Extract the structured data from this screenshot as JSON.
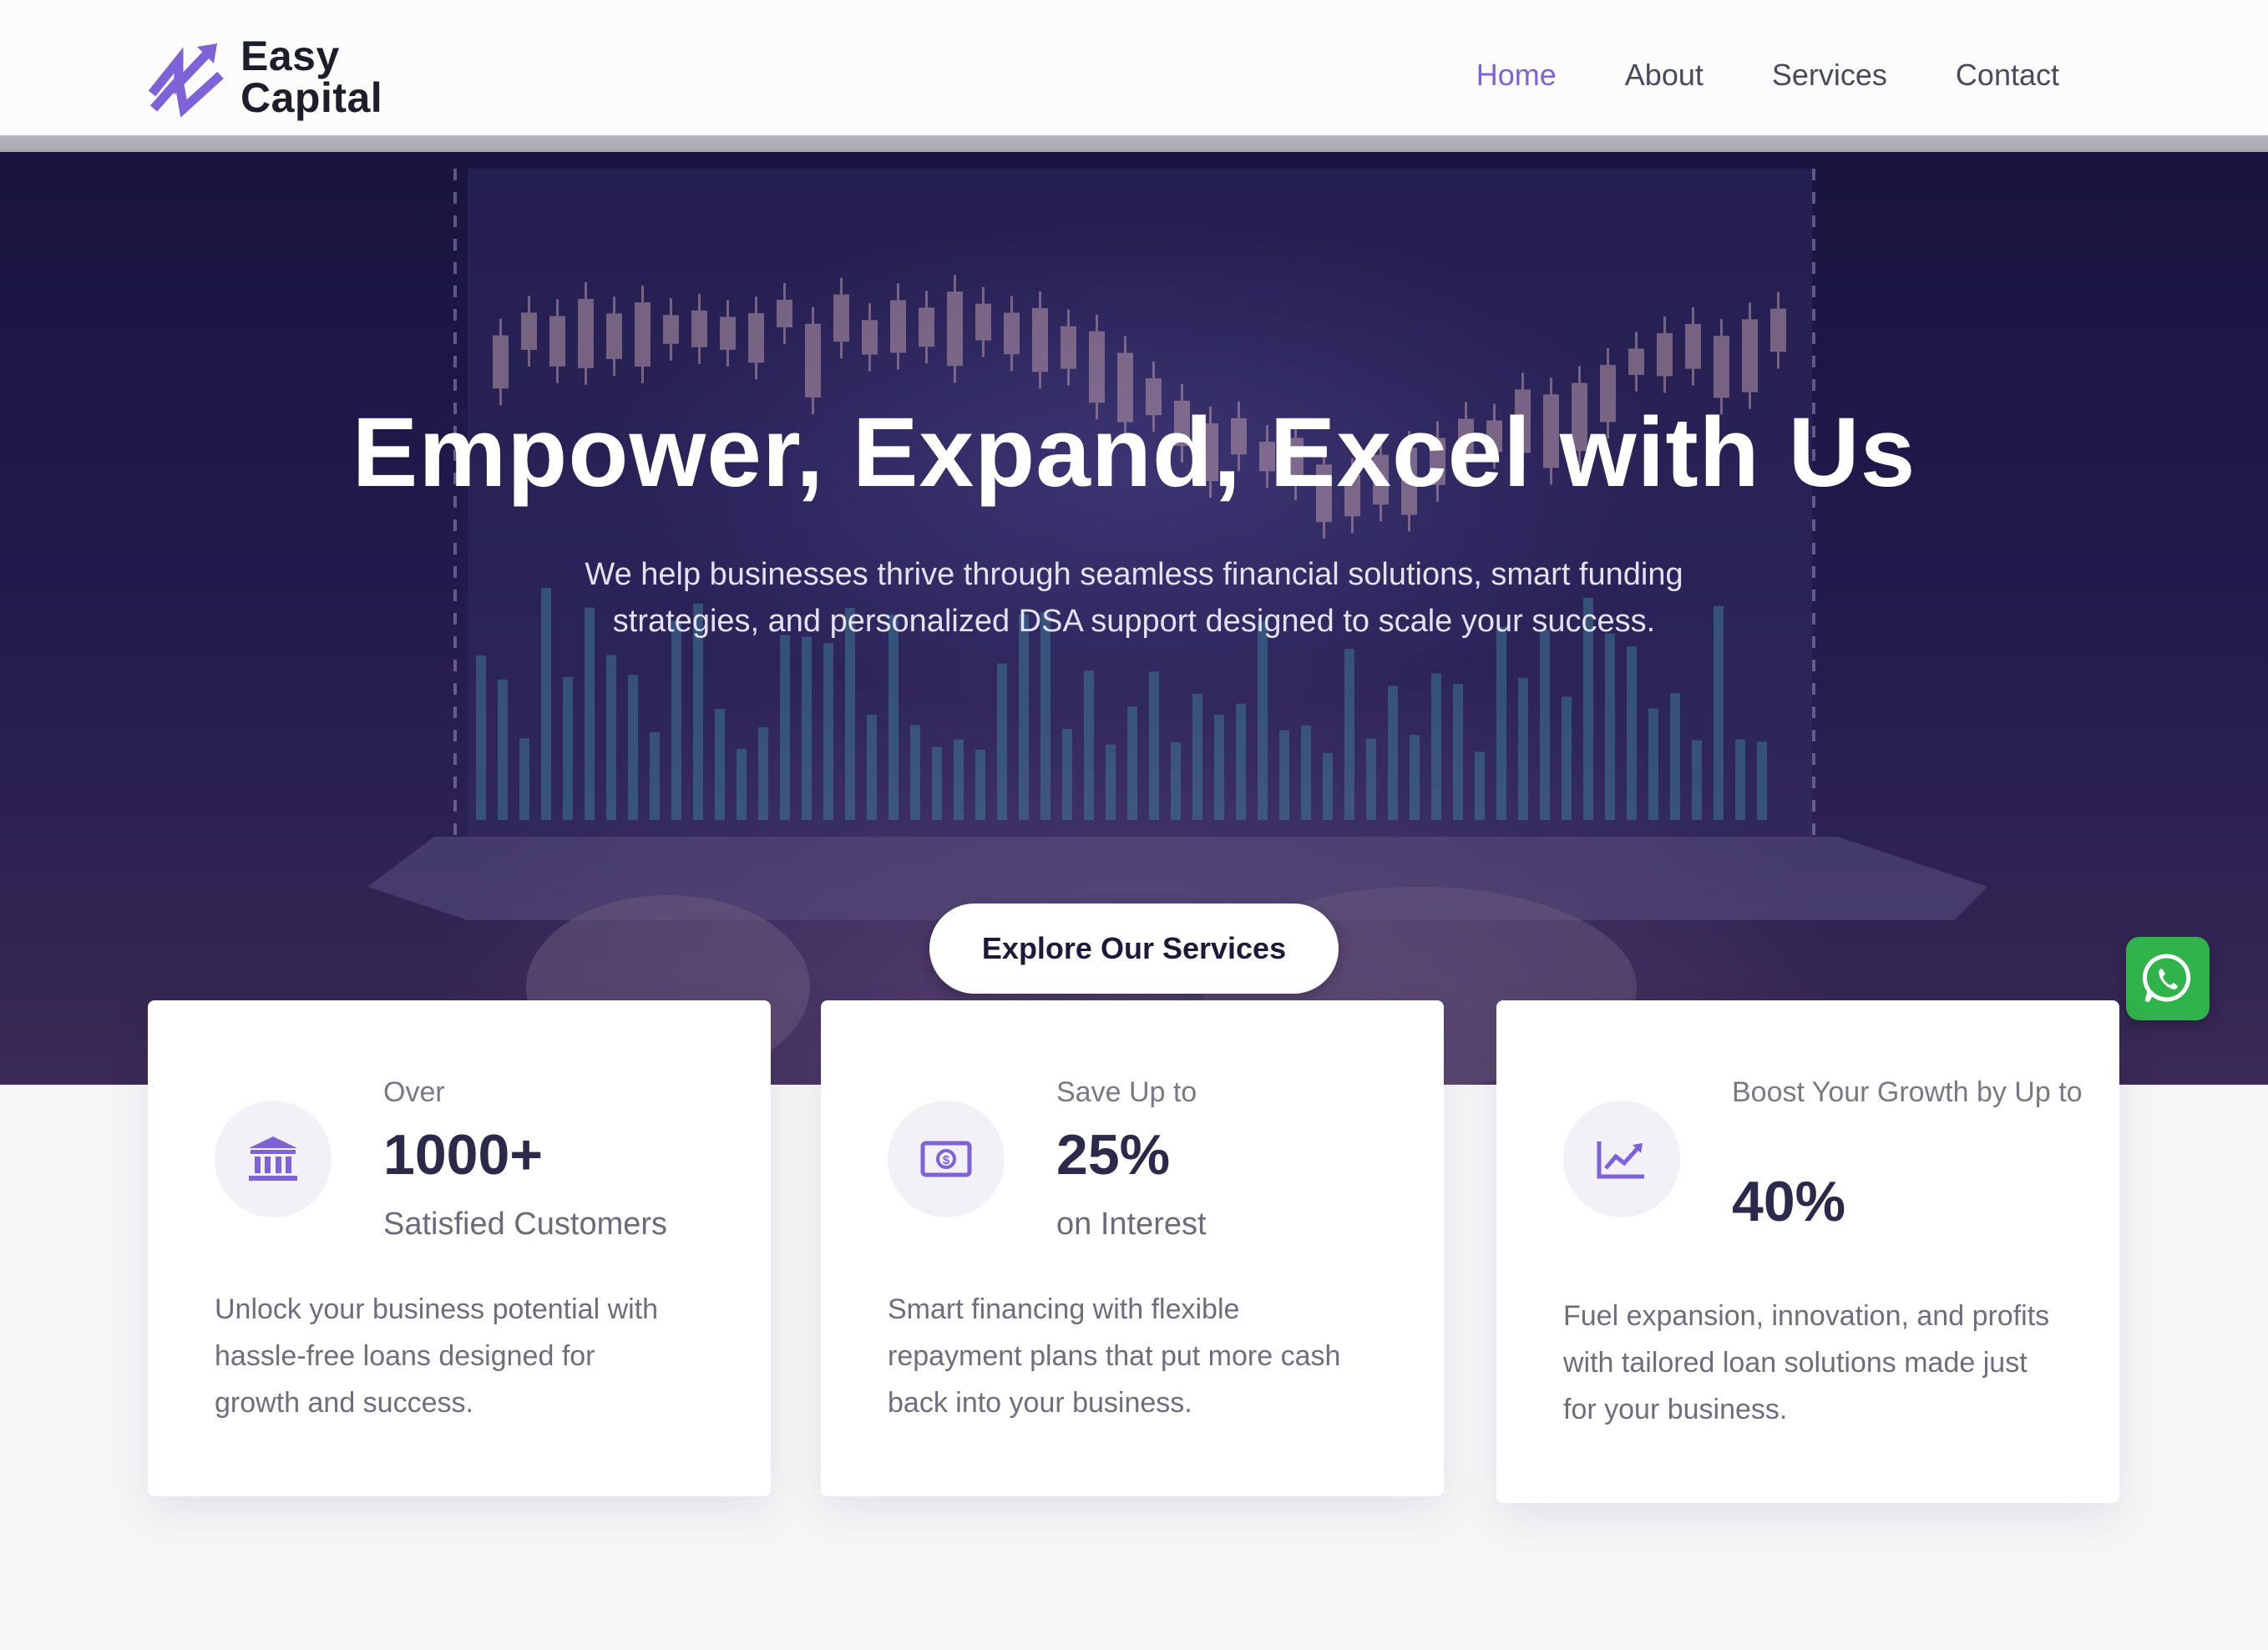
{
  "brand": {
    "line1": "Easy",
    "line2": "Capital",
    "accent_color": "#7d62d8"
  },
  "nav": {
    "items": [
      {
        "label": "Home",
        "active": true
      },
      {
        "label": "About",
        "active": false
      },
      {
        "label": "Services",
        "active": false
      },
      {
        "label": "Contact",
        "active": false
      }
    ]
  },
  "hero": {
    "title": "Empower, Expand, Excel with Us",
    "subtitle": "We help businesses thrive through seamless financial solutions, smart funding strategies, and personalized DSA support designed to scale your success.",
    "cta_label": "Explore Our Services",
    "slides": 2,
    "active_slide": 1
  },
  "stats": [
    {
      "icon": "bank-icon",
      "top": "Over",
      "value": "1000+",
      "bottom": "Satisfied Customers",
      "description": "Unlock your business potential with hassle-free loans designed for growth and success."
    },
    {
      "icon": "cash-icon",
      "top": "Save Up to",
      "value": "25%",
      "bottom": "on Interest",
      "description": "Smart financing with flexible repayment plans that put more cash back into your business."
    },
    {
      "icon": "growth-chart-icon",
      "top": "Boost Your Growth by Up to",
      "value": "40%",
      "bottom": "",
      "description": "Fuel expansion, innovation, and profits with tailored loan solutions made just for your business."
    }
  ],
  "floating": {
    "icon": "whatsapp-icon",
    "color": "#2fb34a"
  }
}
